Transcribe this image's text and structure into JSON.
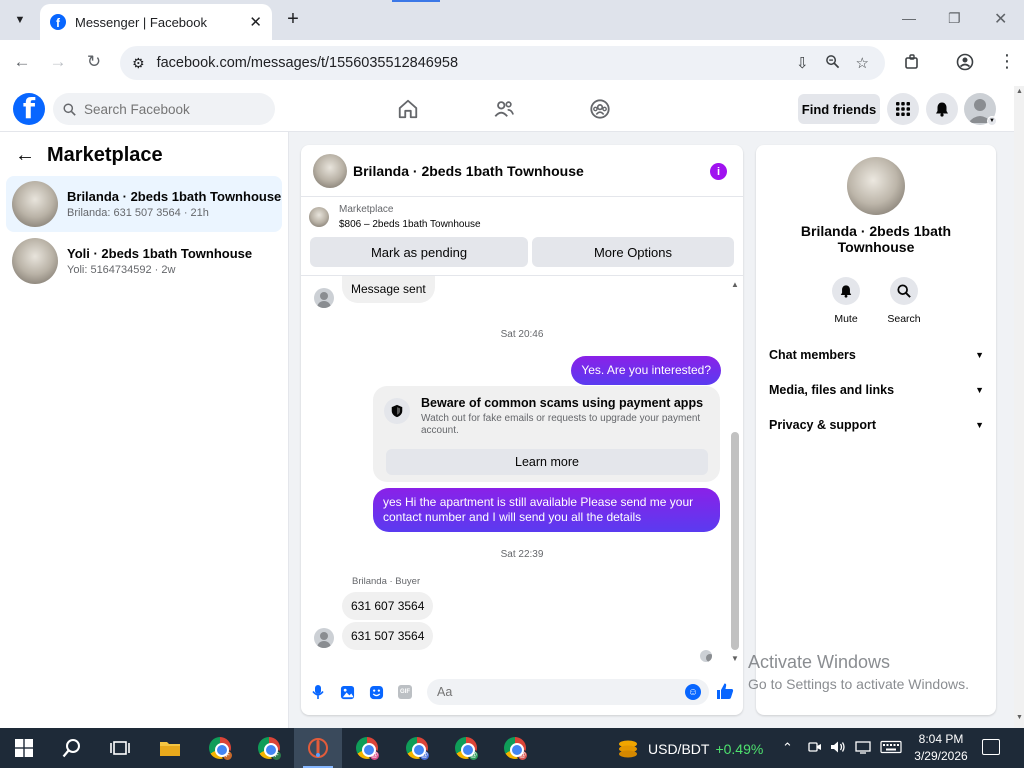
{
  "browser": {
    "tab_title": "Messenger | Facebook",
    "url": "facebook.com/messages/t/1556035512846958",
    "new_tab_symbol": "+",
    "close_symbol": "✕"
  },
  "fb_header": {
    "logo_letter": "f",
    "search_placeholder": "Search Facebook",
    "find_friends_label": "Find friends"
  },
  "sidebar": {
    "title": "Marketplace",
    "conversations": [
      {
        "name": "Brilanda · 2beds 1bath Townhouse",
        "preview": "Brilanda: 631 507 3564 · 21h",
        "active": true
      },
      {
        "name": "Yoli · 2beds 1bath Townhouse",
        "preview": "Yoli: 5164734592 · 2w",
        "active": false
      }
    ]
  },
  "chat": {
    "title": "Brilanda · 2beds 1bath Townhouse",
    "marketplace_label": "Marketplace",
    "listing": "$806 – 2beds 1bath Townhouse",
    "mark_pending_label": "Mark as pending",
    "more_options_label": "More Options",
    "messages": {
      "sent_notice": "Message sent",
      "time_1": "Sat 20:46",
      "out_1": "Yes. Are you interested?",
      "scam_title": "Beware of common scams using payment apps",
      "scam_body": "Watch out for fake emails or requests to upgrade your payment account.",
      "learn_more": "Learn more",
      "out_2": "yes Hi the apartment is still available Please send me your contact number and I will send you all the details",
      "time_2": "Sat 22:39",
      "sender_label": "Brilanda · Buyer",
      "in_1": "631 607 3564",
      "in_2": "631 507 3564"
    },
    "composer_placeholder": "Aa",
    "gif_label": "GIF"
  },
  "right_panel": {
    "name": "Brilanda · 2beds 1bath Townhouse",
    "mute_label": "Mute",
    "search_label": "Search",
    "sections": [
      "Chat members",
      "Media, files and links",
      "Privacy & support"
    ]
  },
  "watermark": {
    "line1": "Activate Windows",
    "line2": "Go to Settings to activate Windows."
  },
  "taskbar": {
    "ticker_label": "USD/BDT",
    "ticker_change": "+0.49%",
    "time": "8:04 PM",
    "date": "3/29/2026"
  },
  "colors": {
    "fb_blue": "#0866ff",
    "bubble_purple": "#7b2ff7",
    "info_purple": "#a012f0",
    "taskbar_bg": "#1e2a38"
  }
}
